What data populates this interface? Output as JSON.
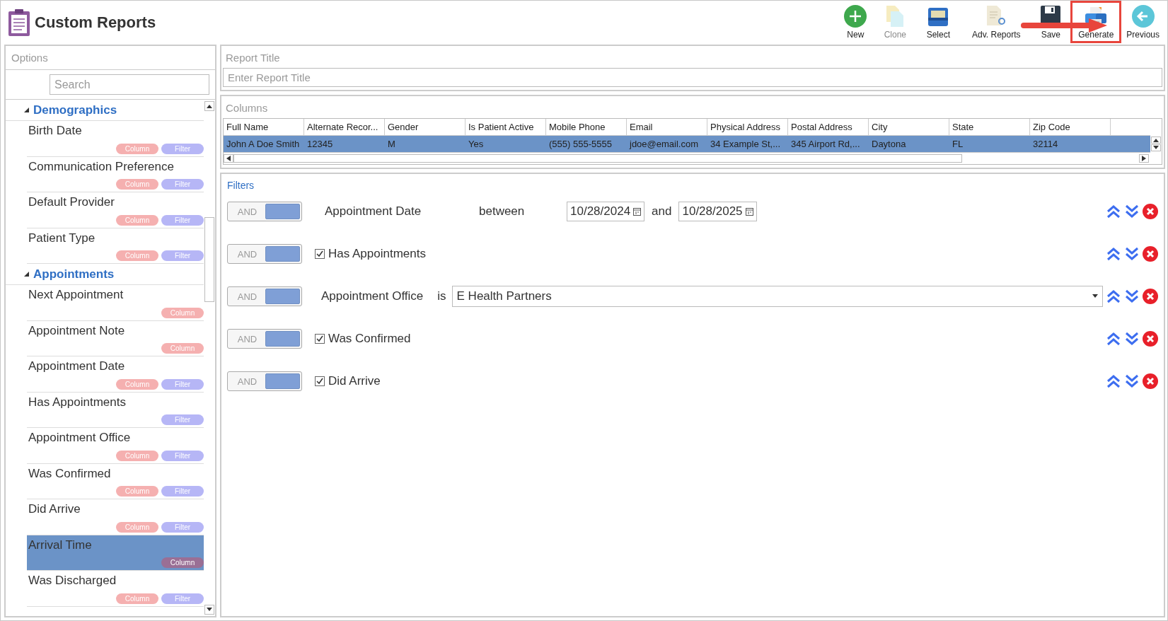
{
  "window": {
    "title": "Custom Reports"
  },
  "toolbar": [
    {
      "kind": "new",
      "label": "New",
      "disabled": false,
      "highlighted": false
    },
    {
      "kind": "clone",
      "label": "Clone",
      "disabled": true,
      "highlighted": false
    },
    {
      "kind": "select",
      "label": "Select",
      "disabled": false,
      "highlighted": false
    },
    {
      "kind": "adv",
      "label": "Adv. Reports",
      "disabled": false,
      "highlighted": false
    },
    {
      "kind": "save",
      "label": "Save",
      "disabled": false,
      "highlighted": false
    },
    {
      "kind": "generate",
      "label": "Generate",
      "disabled": false,
      "highlighted": true
    },
    {
      "kind": "previous",
      "label": "Previous",
      "disabled": false,
      "highlighted": false
    }
  ],
  "options": {
    "title": "Options",
    "search": {
      "placeholder": "Search"
    },
    "groups": [
      {
        "label": "Demographics",
        "expanded": true,
        "items": [
          {
            "label": "Birth Date",
            "selected": false,
            "tags": [
              {
                "kind": "column",
                "label": "Column"
              },
              {
                "kind": "filter",
                "label": "Filter"
              }
            ]
          },
          {
            "label": "Communication Preference",
            "selected": false,
            "tags": [
              {
                "kind": "column",
                "label": "Column"
              },
              {
                "kind": "filter",
                "label": "Filter"
              }
            ]
          },
          {
            "label": "Default Provider",
            "selected": false,
            "tags": [
              {
                "kind": "column",
                "label": "Column"
              },
              {
                "kind": "filter",
                "label": "Filter"
              }
            ]
          },
          {
            "label": "Patient Type",
            "selected": false,
            "tags": [
              {
                "kind": "column",
                "label": "Column"
              },
              {
                "kind": "filter",
                "label": "Filter"
              }
            ]
          }
        ]
      },
      {
        "label": "Appointments",
        "expanded": true,
        "items": [
          {
            "label": "Next Appointment",
            "selected": false,
            "tags": [
              {
                "kind": "column",
                "label": "Column"
              }
            ]
          },
          {
            "label": "Appointment Note",
            "selected": false,
            "tags": [
              {
                "kind": "column",
                "label": "Column"
              }
            ]
          },
          {
            "label": "Appointment Date",
            "selected": false,
            "tags": [
              {
                "kind": "column",
                "label": "Column"
              },
              {
                "kind": "filter",
                "label": "Filter"
              }
            ]
          },
          {
            "label": "Has Appointments",
            "selected": false,
            "tags": [
              {
                "kind": "filter",
                "label": "Filter"
              }
            ]
          },
          {
            "label": "Appointment Office",
            "selected": false,
            "tags": [
              {
                "kind": "column",
                "label": "Column"
              },
              {
                "kind": "filter",
                "label": "Filter"
              }
            ]
          },
          {
            "label": "Was Confirmed",
            "selected": false,
            "tags": [
              {
                "kind": "column",
                "label": "Column"
              },
              {
                "kind": "filter",
                "label": "Filter"
              }
            ]
          },
          {
            "label": "Did Arrive",
            "selected": false,
            "tags": [
              {
                "kind": "column",
                "label": "Column"
              },
              {
                "kind": "filter",
                "label": "Filter"
              }
            ]
          },
          {
            "label": "Arrival Time",
            "selected": true,
            "tags": [
              {
                "kind": "column",
                "label": "Column"
              }
            ]
          },
          {
            "label": "Was Discharged",
            "selected": false,
            "tags": [
              {
                "kind": "column",
                "label": "Column"
              },
              {
                "kind": "filter",
                "label": "Filter"
              }
            ]
          }
        ]
      }
    ]
  },
  "report_title": {
    "label": "Report Title",
    "placeholder": "Enter Report Title"
  },
  "columns": {
    "label": "Columns",
    "headers": [
      "Full Name",
      "Alternate Recor...",
      "Gender",
      "Is Patient Active",
      "Mobile Phone",
      "Email",
      "Physical Address",
      "Postal Address",
      "City",
      "State",
      "Zip Code"
    ],
    "rows": [
      {
        "selected": true,
        "cells": [
          "John A Doe Smith",
          "12345",
          "M",
          "Yes",
          "(555) 555-5555",
          "jdoe@email.com",
          "34 Example St,...",
          "345 Airport Rd,...",
          "Daytona",
          "FL",
          "32114"
        ]
      }
    ]
  },
  "filters": {
    "label": "Filters",
    "rows": [
      {
        "kind": "range",
        "operator": "AND",
        "field": "Appointment Date",
        "relation": "between",
        "from": "10/28/2024",
        "joiner": "and",
        "to": "10/28/2025"
      },
      {
        "kind": "checkbox",
        "operator": "AND",
        "field": "Has Appointments",
        "checked": true
      },
      {
        "kind": "select",
        "operator": "AND",
        "field": "Appointment Office",
        "relation": "is",
        "value": "E Health Partners"
      },
      {
        "kind": "checkbox",
        "operator": "AND",
        "field": "Was Confirmed",
        "checked": true
      },
      {
        "kind": "checkbox",
        "operator": "AND",
        "field": "Did Arrive",
        "checked": true
      }
    ]
  }
}
